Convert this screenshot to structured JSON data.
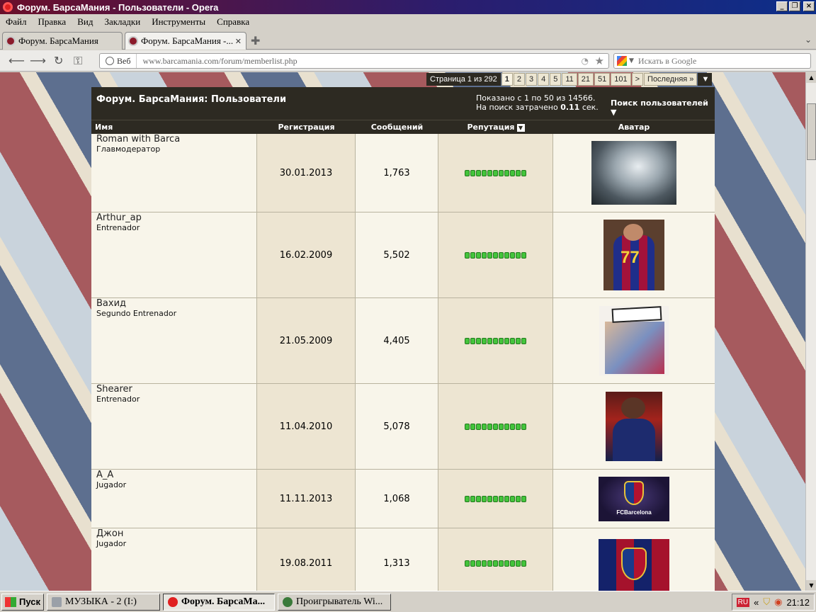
{
  "window": {
    "title": "Форум. БарсаМания - Пользователи - Opera"
  },
  "menu": [
    "Файл",
    "Правка",
    "Вид",
    "Закладки",
    "Инструменты",
    "Справка"
  ],
  "tabs": [
    {
      "label": "Форум. БарсаМания"
    },
    {
      "label": "Форум. БарсаМания -..."
    }
  ],
  "address": {
    "scope": "Веб",
    "url": "www.barcamania.com/forum/memberlist.php"
  },
  "search": {
    "placeholder": "Искать в Google"
  },
  "pagination": {
    "label": "Страница 1 из 292",
    "pages": [
      "1",
      "2",
      "3",
      "4",
      "5",
      "11",
      "21",
      "51",
      "101",
      ">",
      "Последняя »"
    ],
    "current": "1"
  },
  "forum": {
    "title": "Форум. БарсаМания: Пользователи",
    "shown": "Показано с 1 по 50 из 14566.",
    "time_prefix": "На поиск затрачено",
    "time_value": "0.11",
    "time_suffix": "сек.",
    "search_users": "Поиск пользователей",
    "columns": {
      "name": "Имя",
      "reg": "Регистрация",
      "posts": "Сообщений",
      "rep": "Репутация",
      "avatar": "Аватар"
    }
  },
  "members": [
    {
      "name": "Roman with Barca",
      "rank": "Главмодератор",
      "reg": "30.01.2013",
      "posts": "1,763",
      "rep": 11,
      "avatar": "silver-surfer-avatar"
    },
    {
      "name": "Arthur_ap",
      "rank": "Entrenador",
      "reg": "16.02.2009",
      "posts": "5,502",
      "rep": 11,
      "avatar": "barca-jersey-77-avatar"
    },
    {
      "name": "Вахид",
      "rank": "Segundo Entrenador",
      "reg": "21.05.2009",
      "posts": "4,405",
      "rep": 11,
      "avatar": "cantera-kids-avatar"
    },
    {
      "name": "Shearer",
      "rank": "Entrenador",
      "reg": "11.04.2010",
      "posts": "5,078",
      "rep": 11,
      "avatar": "rooney-avatar"
    },
    {
      "name": "A_A",
      "rank": "Jugador",
      "reg": "11.11.2013",
      "posts": "1,068",
      "rep": 11,
      "avatar": "fcb-crest-purple-avatar"
    },
    {
      "name": "Джон",
      "rank": "Jugador",
      "reg": "19.08.2011",
      "posts": "1,313",
      "rep": 11,
      "avatar": "fcb-crest-stripes-avatar"
    }
  ],
  "taskbar": {
    "start": "Пуск",
    "tasks": [
      "МУЗЫКА - 2 (I:)",
      "Форум. БарсаМа...",
      "Проигрыватель Wi..."
    ],
    "lang": "RU",
    "clock": "21:12"
  },
  "colors": {
    "forum_header": "#2d2a22",
    "rep_green": "#44c43c",
    "row_bg": "#f8f5ea",
    "alt_col_bg": "#ede5d2"
  }
}
